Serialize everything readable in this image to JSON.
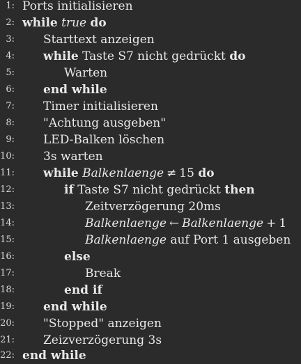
{
  "lines": [
    {
      "n": "1:",
      "parts": [
        "Ports initialisieren"
      ]
    },
    {
      "n": "2:",
      "parts": [
        "while",
        "true",
        "do"
      ]
    },
    {
      "n": "3:",
      "parts": [
        "Starttext anzeigen"
      ]
    },
    {
      "n": "4:",
      "parts": [
        "while",
        "Taste S7 nicht gedrückt",
        "do"
      ]
    },
    {
      "n": "5:",
      "parts": [
        "Warten"
      ]
    },
    {
      "n": "6:",
      "parts": [
        "end while"
      ]
    },
    {
      "n": "7:",
      "parts": [
        "Timer initialisieren"
      ]
    },
    {
      "n": "8:",
      "parts": [
        "\"Achtung ausgeben\""
      ]
    },
    {
      "n": "9:",
      "parts": [
        "LED-Balken löschen"
      ]
    },
    {
      "n": "10:",
      "parts": [
        "3s warten"
      ]
    },
    {
      "n": "11:",
      "parts": [
        "while",
        "Balkenlaenge",
        "≠",
        "15",
        "do"
      ]
    },
    {
      "n": "12:",
      "parts": [
        "if",
        "Taste S7 nicht gedrückt",
        "then"
      ]
    },
    {
      "n": "13:",
      "parts": [
        "Zeitverzögerung 20ms"
      ]
    },
    {
      "n": "14:",
      "parts": [
        "Balkenlaenge",
        "←",
        "Balkenlaenge",
        "+",
        "1"
      ]
    },
    {
      "n": "15:",
      "parts": [
        "Balkenlaenge",
        "auf Port 1 ausgeben"
      ]
    },
    {
      "n": "16:",
      "parts": [
        "else"
      ]
    },
    {
      "n": "17:",
      "parts": [
        "Break"
      ]
    },
    {
      "n": "18:",
      "parts": [
        "end if"
      ]
    },
    {
      "n": "19:",
      "parts": [
        "end while"
      ]
    },
    {
      "n": "20:",
      "parts": [
        "\"Stopped\" anzeigen"
      ]
    },
    {
      "n": "21:",
      "parts": [
        "Zeizverzögerung 3s"
      ]
    },
    {
      "n": "22:",
      "parts": [
        "end while"
      ]
    }
  ]
}
